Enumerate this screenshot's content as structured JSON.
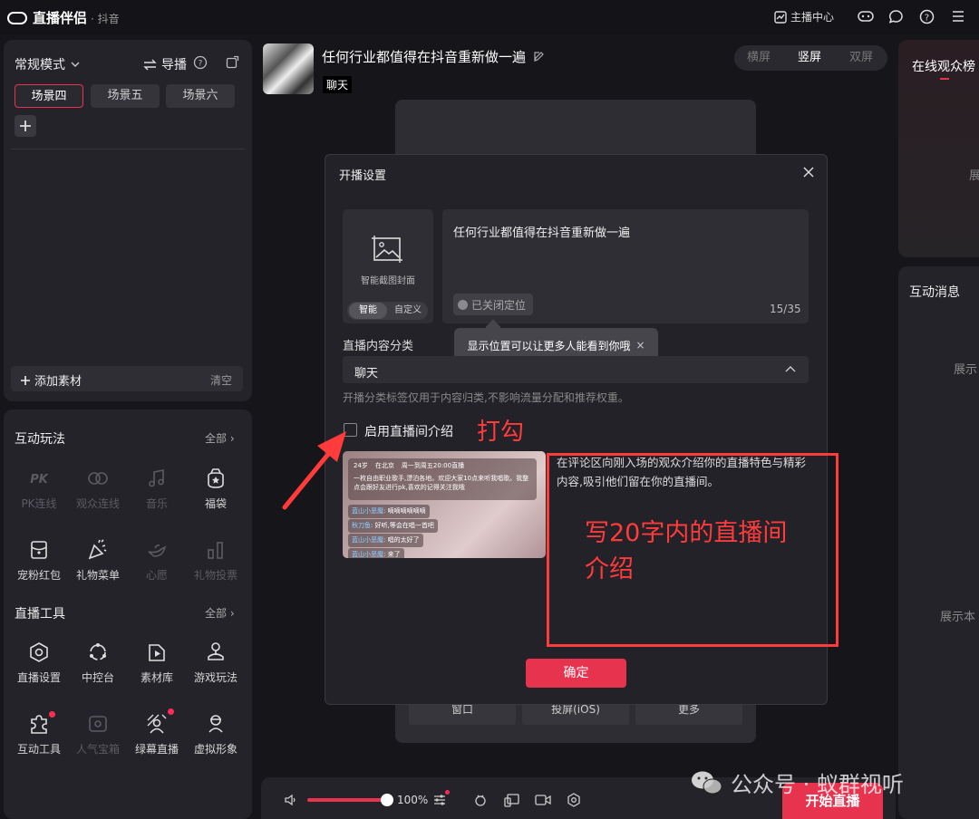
{
  "topbar": {
    "app_name": "直播伴侣",
    "platform": "· 抖音",
    "host_center": "主播中心"
  },
  "left": {
    "mode_label": "常规模式",
    "guide_label": "导播",
    "scenes": [
      "场景四",
      "场景五",
      "场景六"
    ],
    "add_material": "添加素材",
    "clear": "清空",
    "interactive": {
      "title": "互动玩法",
      "all": "全部",
      "items": [
        "PK连线",
        "观众连线",
        "音乐",
        "福袋",
        "宠粉红包",
        "礼物菜单",
        "心愿",
        "礼物投票"
      ]
    },
    "tools": {
      "title": "直播工具",
      "all": "全部",
      "items": [
        "直播设置",
        "中控台",
        "素材库",
        "游戏玩法",
        "互动工具",
        "人气宝箱",
        "绿幕直播",
        "虚拟形象"
      ]
    }
  },
  "stream": {
    "title": "任何行业都值得在抖音重新做一遍",
    "tag": "聊天",
    "orient": [
      "横屏",
      "竖屏",
      "双屏"
    ],
    "bottom_items": [
      "窗口",
      "投屏(iOS)",
      "更多"
    ]
  },
  "right": {
    "online_rank": "在线观众榜",
    "messages": "互动消息",
    "show1": "展",
    "show2": "展示",
    "show3": "展示本"
  },
  "bottombar": {
    "volume": "100%",
    "start": "开始直播"
  },
  "dialog": {
    "title": "开播设置",
    "cover_label": "智能截图封面",
    "cover_tab1": "智能",
    "cover_tab2": "自定义",
    "title_text": "任何行业都值得在抖音重新做一遍",
    "location": "已关闭定位",
    "counter": "15/35",
    "tooltip": "显示位置可以让更多人能看到你哦",
    "category_label": "直播内容分类",
    "category_value": "聊天",
    "category_note": "开播分类标签仅用于内容归类,不影响流量分配和推荐权重。",
    "intro_checkbox": "启用直播间介绍",
    "intro_desc": "在评论区向刚入场的观众介绍你的直播特色与精彩内容,吸引他们留在你的直播间。",
    "confirm": "确定",
    "preview": {
      "age": "24岁",
      "city": "在北京",
      "time": "周一到周五20:00直播",
      "intro": "一枚自由职业歌手,漂泊各地。欢迎大家10点来听我唱歌。我整点会跟好友进行pk,喜欢的记得关注我哦",
      "comments": [
        {
          "user": "蓝山小恶魔",
          "text": "嘀嘀嘀嘀嘀嘀"
        },
        {
          "user": "秋刀鱼",
          "text": "好听,等会在唱一首吧"
        },
        {
          "user": "蓝山小恶魔",
          "text": "唱的太好了"
        },
        {
          "user": "蓝山小恶魔",
          "text": "来了"
        }
      ]
    }
  },
  "annotations": {
    "check": "打勾",
    "write_line1": "写20字内的直播间",
    "write_line2": "介绍"
  },
  "watermark": "公众号 · 蚁群视听"
}
